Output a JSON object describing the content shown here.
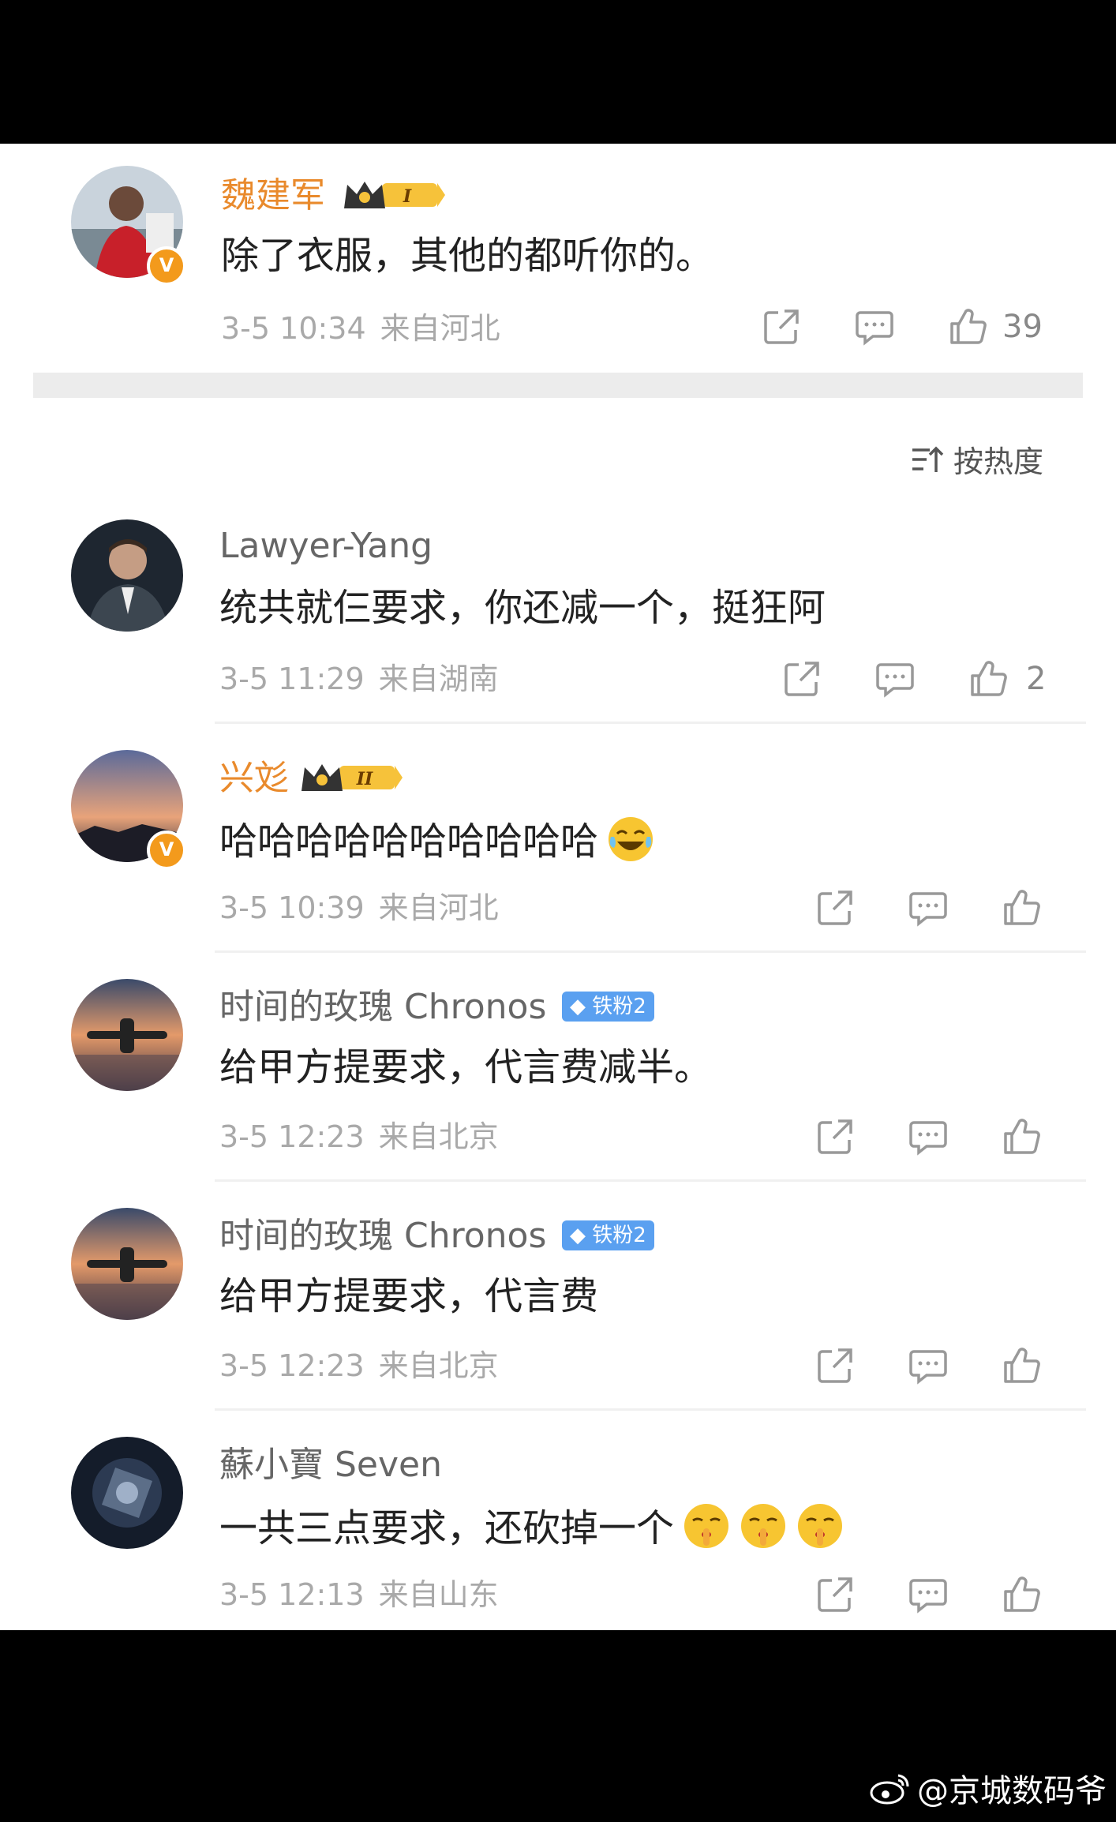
{
  "post": {
    "author": "魏建军",
    "crown_level": "I",
    "text": "除了衣服，其他的都听你的。",
    "date": "3-5 10:34",
    "location": "来自河北",
    "likes": "39"
  },
  "sort_label": "按热度",
  "comments": [
    {
      "name": "Lawyer-Yang",
      "text": "统共就仨要求，你还减一个，挺狂阿",
      "date": "3-5 11:29",
      "location": "来自湖南",
      "likes": "2"
    },
    {
      "name": "兴彣",
      "crown_level": "II",
      "text": "哈哈哈哈哈哈哈哈哈哈",
      "emoji": "laughing-tears",
      "date": "3-5 10:39",
      "location": "来自河北"
    },
    {
      "name": "时间的玫瑰 Chronos",
      "badge": "铁粉2",
      "text": "给甲方提要求，代言费减半。",
      "date": "3-5 12:23",
      "location": "来自北京"
    },
    {
      "name": "时间的玫瑰 Chronos",
      "badge": "铁粉2",
      "text": "给甲方提要求，代言费",
      "date": "3-5 12:23",
      "location": "来自北京"
    },
    {
      "name": "蘇小寶 Seven",
      "text": "一共三点要求，还砍掉一个",
      "emoji": "shush-face x3",
      "date": "3-5 12:13",
      "location": "来自山东"
    }
  ],
  "watermark": "@京城数码爷",
  "colors": {
    "vip_name": "#e98a2c",
    "verified": "#f39a1c",
    "fan_badge": "#5aa0f0"
  }
}
